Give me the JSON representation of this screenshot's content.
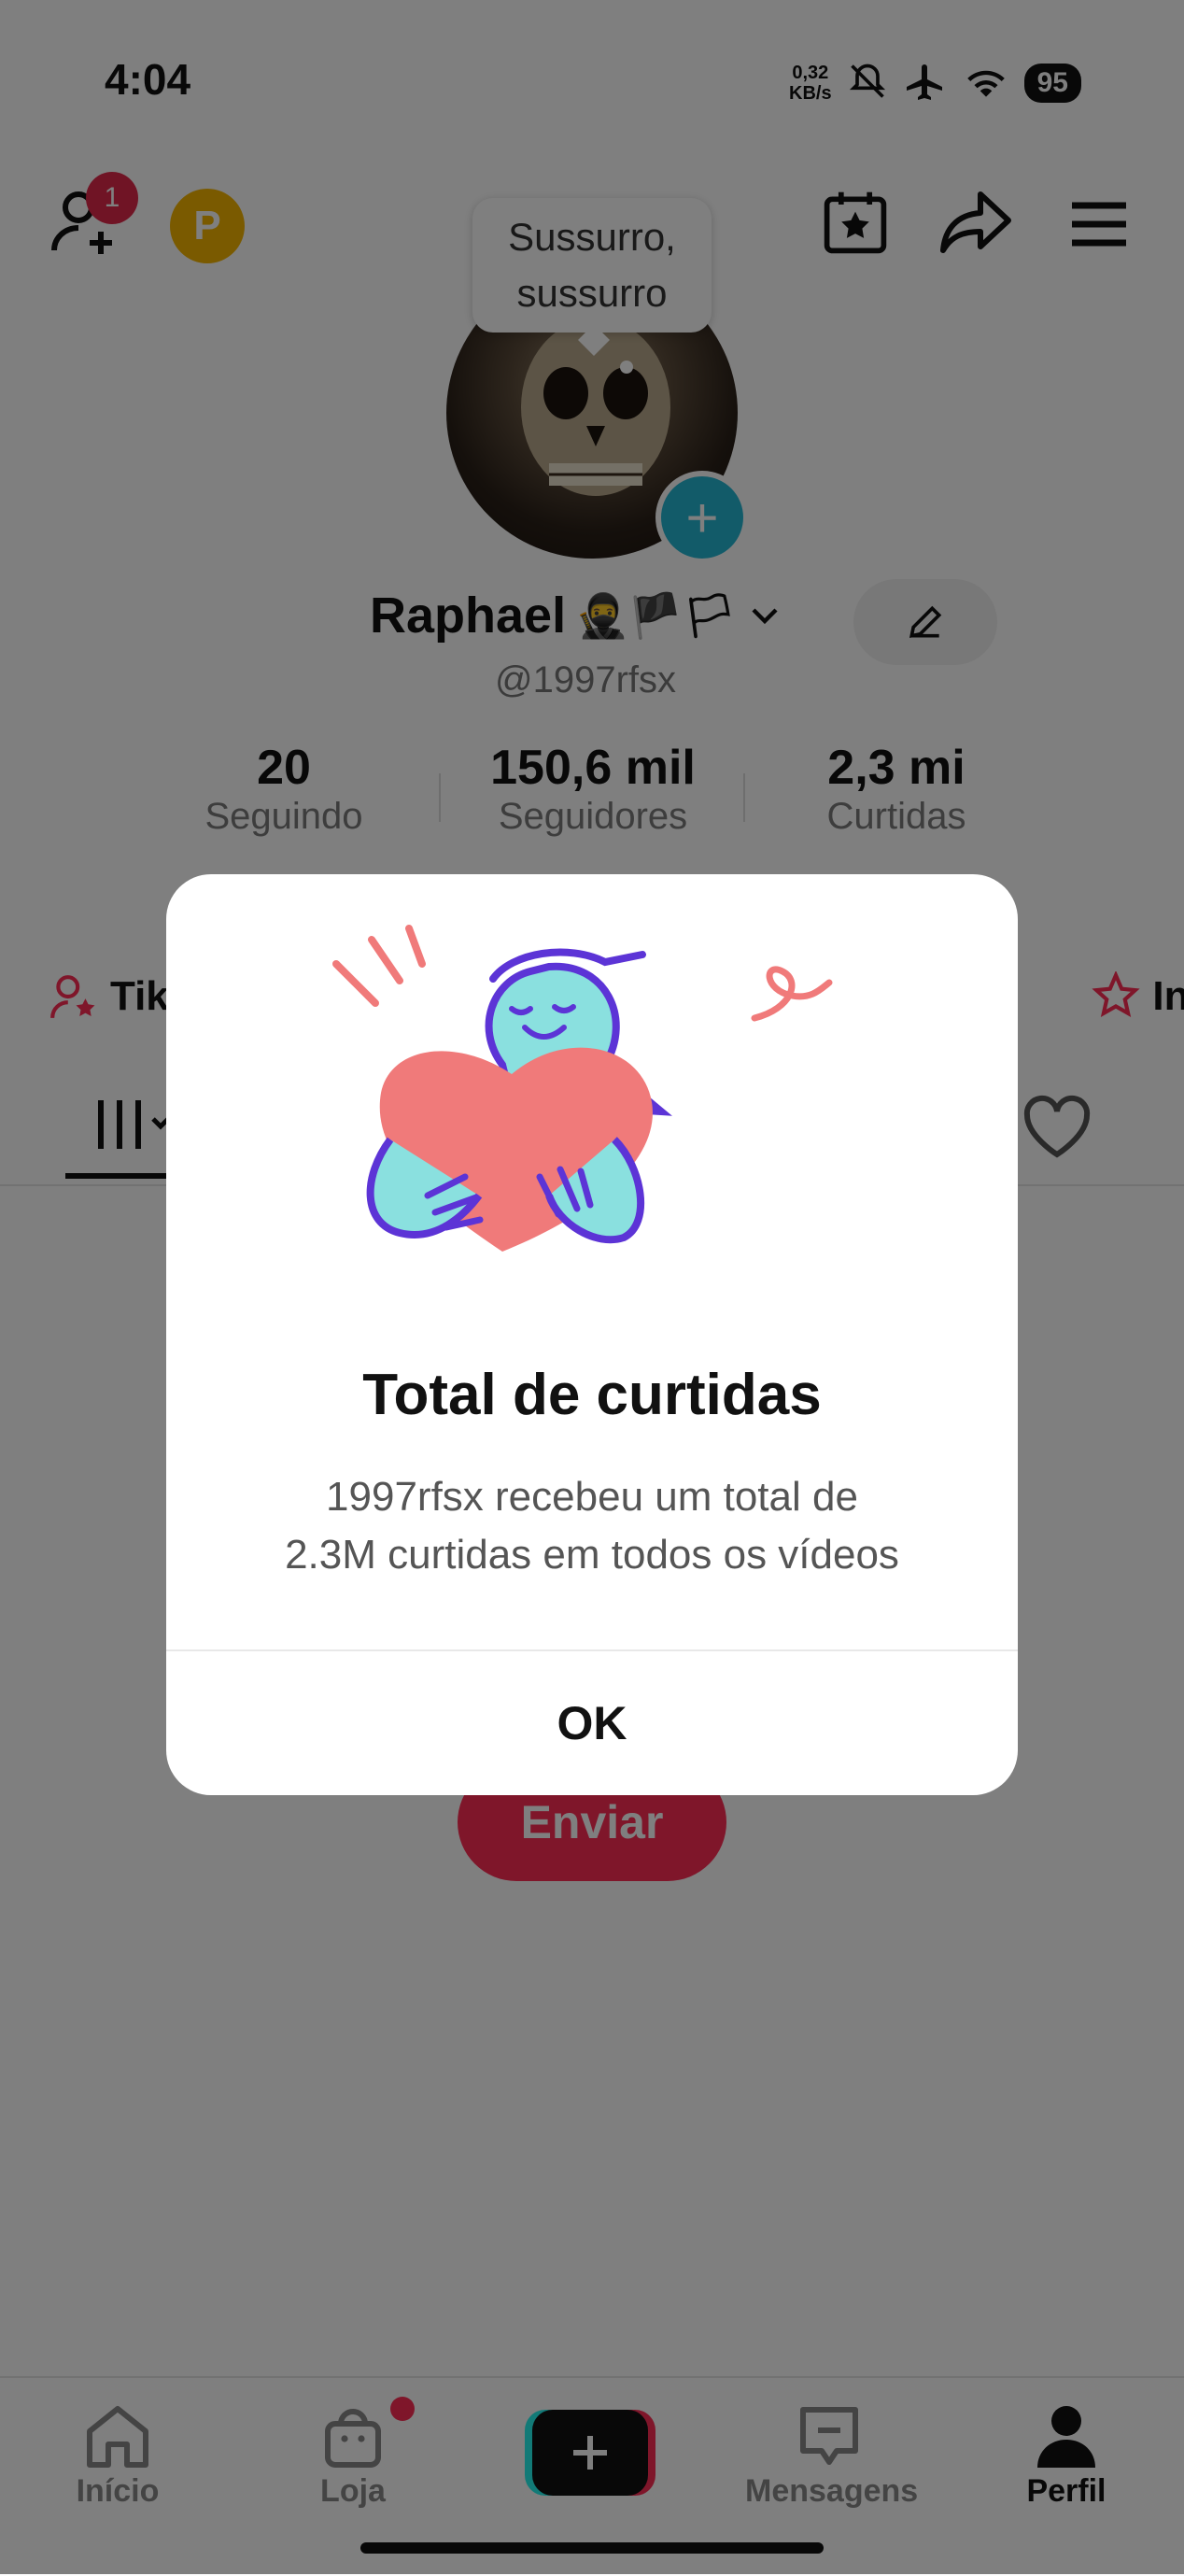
{
  "status_bar": {
    "time": "4:04",
    "net_speed_value": "0,32",
    "net_speed_unit": "KB/s",
    "battery": "95"
  },
  "header": {
    "notification_count": "1",
    "tooltip_line1": "Sussurro,",
    "tooltip_line2": "sussurro"
  },
  "profile": {
    "name": "Raphael",
    "name_emojis": "🥷🏴🏳",
    "handle": "@1997rfsx",
    "stats": [
      {
        "value": "20",
        "label": "Seguindo"
      },
      {
        "value": "150,6 mil",
        "label": "Seguidores"
      },
      {
        "value": "2,3 mi",
        "label": "Curtidas"
      }
    ],
    "link_left": "Tik",
    "link_right": "Ins",
    "send_label": "Enviar"
  },
  "modal": {
    "title": "Total de curtidas",
    "body_line1": "1997rfsx recebeu um total de",
    "body_line2": "2.3M curtidas em todos os vídeos",
    "ok_label": "OK"
  },
  "bottom_nav": {
    "items": [
      {
        "label": "Início",
        "icon": "home-icon"
      },
      {
        "label": "Loja",
        "icon": "shop-bag-icon"
      },
      {
        "label": "Mensagens",
        "icon": "message-icon"
      },
      {
        "label": "Perfil",
        "icon": "profile-icon"
      }
    ],
    "accent_colors": {
      "brand_red": "#fe2c55",
      "brand_cyan": "#25f4ee"
    }
  }
}
